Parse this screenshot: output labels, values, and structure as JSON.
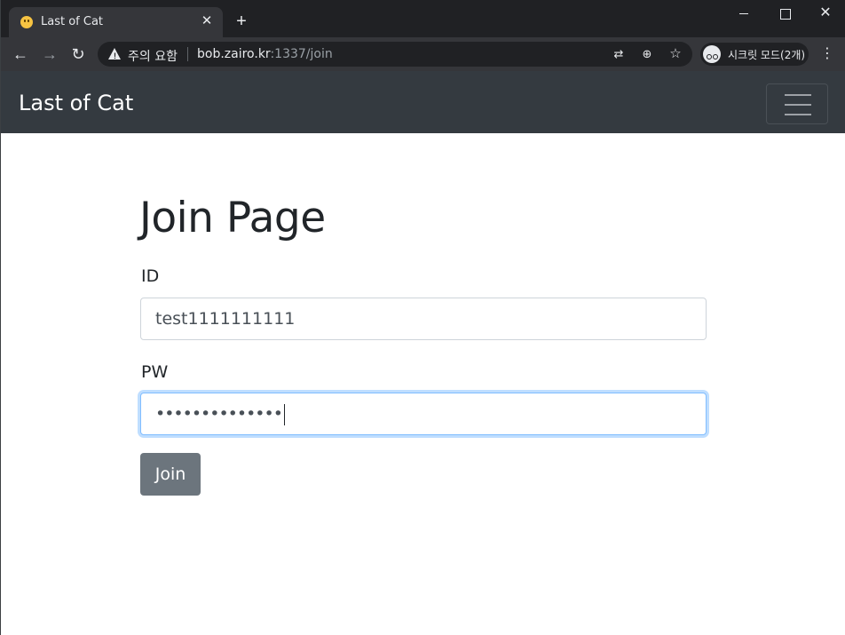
{
  "browser": {
    "tab_title": "Last of Cat",
    "tab_close": "✕",
    "new_tab": "+",
    "window_close": "✕",
    "nav_back": "←",
    "nav_forward": "→",
    "nav_reload": "↻",
    "security_warning": "주의 요함",
    "url_host": "bob.zairo.kr",
    "url_path": ":1337/join",
    "incognito_label": "시크릿 모드(2개)",
    "menu": "⋮",
    "icons": [
      "favicon-icon",
      "close-icon",
      "plus-icon",
      "warning-icon",
      "translate-icon",
      "zoom-icon",
      "star-icon",
      "incognito-icon",
      "menu-icon"
    ]
  },
  "navbar": {
    "brand": "Last of Cat"
  },
  "form": {
    "title": "Join Page",
    "id_label": "ID",
    "id_value": "test1111111111",
    "pw_label": "PW",
    "pw_value": "••••••••••••••",
    "submit_label": "Join"
  },
  "colors": {
    "navbar_bg": "#343a40",
    "button_bg": "#6c757d",
    "focus_border": "#80bdff"
  }
}
